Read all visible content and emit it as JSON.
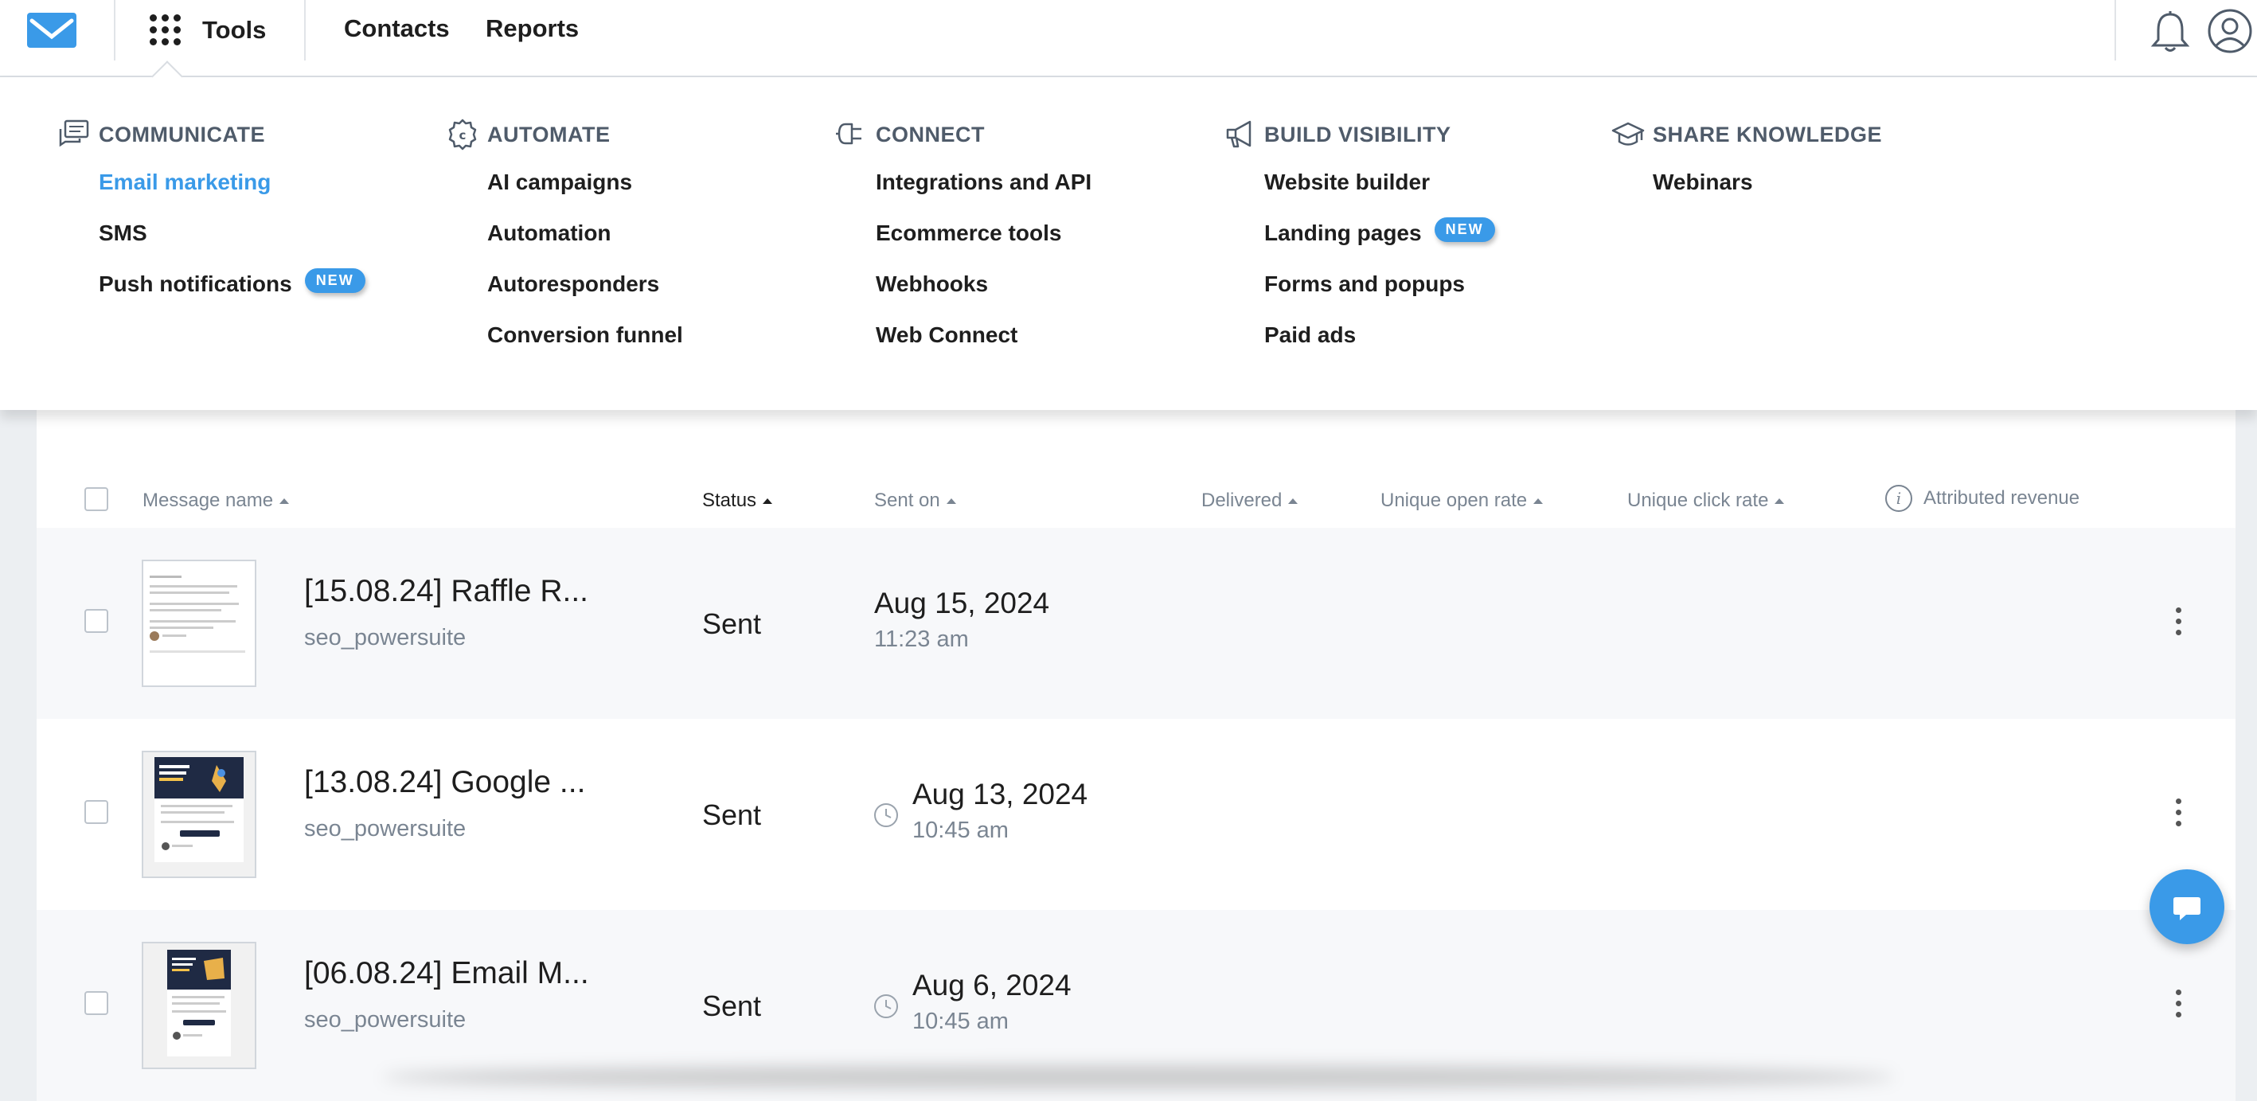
{
  "nav": {
    "tools_label": "Tools",
    "contacts_label": "Contacts",
    "reports_label": "Reports"
  },
  "menu": {
    "columns": [
      {
        "title": "COMMUNICATE",
        "icon": "chat-bubbles-icon",
        "items": [
          {
            "label": "Email marketing",
            "active": true
          },
          {
            "label": "SMS"
          },
          {
            "label": "Push notifications",
            "badge": "NEW"
          }
        ]
      },
      {
        "title": "AUTOMATE",
        "icon": "gear-icon",
        "items": [
          {
            "label": "AI campaigns"
          },
          {
            "label": "Automation"
          },
          {
            "label": "Autoresponders"
          },
          {
            "label": "Conversion funnel"
          }
        ]
      },
      {
        "title": "CONNECT",
        "icon": "plug-icon",
        "items": [
          {
            "label": "Integrations and API"
          },
          {
            "label": "Ecommerce tools"
          },
          {
            "label": "Webhooks"
          },
          {
            "label": "Web Connect"
          }
        ]
      },
      {
        "title": "BUILD VISIBILITY",
        "icon": "megaphone-icon",
        "items": [
          {
            "label": "Website builder"
          },
          {
            "label": "Landing pages",
            "badge": "NEW"
          },
          {
            "label": "Forms and popups"
          },
          {
            "label": "Paid ads"
          }
        ]
      },
      {
        "title": "SHARE KNOWLEDGE",
        "icon": "graduation-cap-icon",
        "items": [
          {
            "label": "Webinars"
          }
        ]
      }
    ]
  },
  "table": {
    "headers": {
      "message_name": "Message name",
      "status": "Status",
      "sent_on": "Sent on",
      "delivered": "Delivered",
      "unique_open_rate": "Unique open rate",
      "unique_click_rate": "Unique click rate",
      "attributed_revenue": "Attributed revenue"
    },
    "rows": [
      {
        "name": "[15.08.24] Raffle R...",
        "from": "seo_powersuite",
        "status": "Sent",
        "date": "Aug 15, 2024",
        "time": "11:23 am",
        "scheduled": false
      },
      {
        "name": "[13.08.24] Google ...",
        "from": "seo_powersuite",
        "status": "Sent",
        "date": "Aug 13, 2024",
        "time": "10:45 am",
        "scheduled": true
      },
      {
        "name": "[06.08.24] Email M...",
        "from": "seo_powersuite",
        "status": "Sent",
        "date": "Aug 6, 2024",
        "time": "10:45 am",
        "scheduled": true
      }
    ]
  },
  "colors": {
    "accent": "#3a9ae8",
    "muted_text": "#7a8592",
    "header_text": "#4f5b6a"
  }
}
